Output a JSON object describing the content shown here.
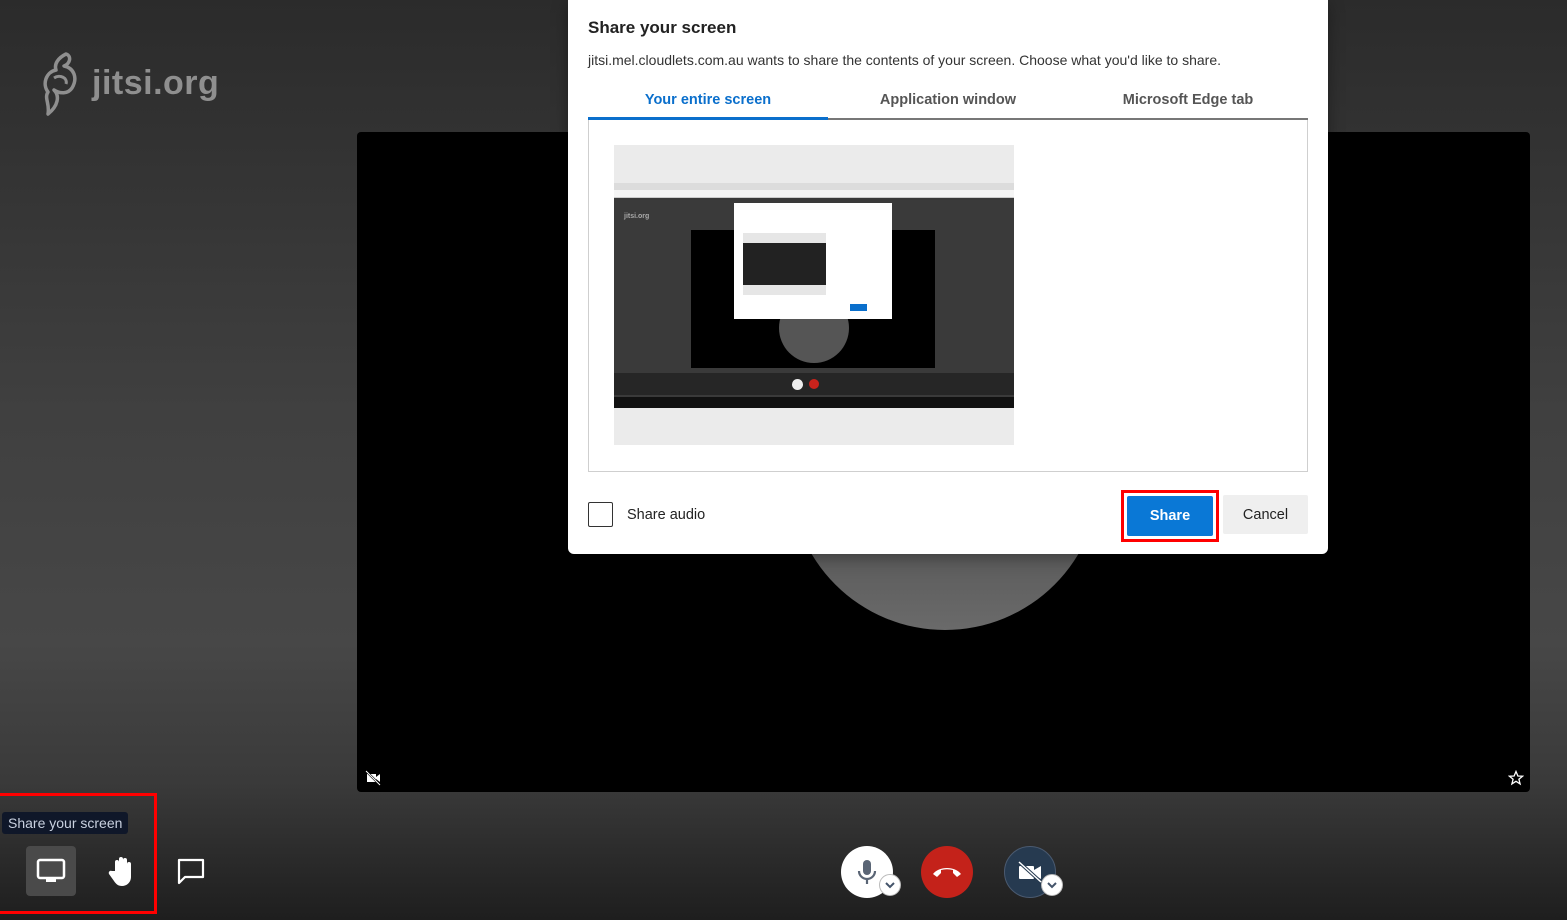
{
  "app": {
    "logo_text": "jitsi.org"
  },
  "dialog": {
    "title": "Share your screen",
    "description": "jitsi.mel.cloudlets.com.au wants to share the contents of your screen. Choose what you'd like to share.",
    "tabs": [
      {
        "label": "Your entire screen",
        "active": true
      },
      {
        "label": "Application window",
        "active": false
      },
      {
        "label": "Microsoft Edge tab",
        "active": false
      }
    ],
    "thumbnail": {
      "name": "Entire screen preview",
      "mini_logo": "jitsi.org"
    },
    "share_audio": {
      "label": "Share audio",
      "checked": false
    },
    "share_button": "Share",
    "cancel_button": "Cancel",
    "accent_color": "#0a78d6"
  },
  "stage": {
    "camera_status": "camera-off",
    "pinned": false
  },
  "toolbar": {
    "tooltip": "Share your screen",
    "left_buttons": [
      {
        "icon": "monitor-icon",
        "label": "Share your screen",
        "active": true
      },
      {
        "icon": "raise-hand-icon",
        "label": "Raise hand"
      },
      {
        "icon": "chat-icon",
        "label": "Chat"
      }
    ],
    "center_buttons": [
      {
        "icon": "microphone-icon",
        "label": "Mute microphone"
      },
      {
        "icon": "hangup-icon",
        "label": "Leave meeting",
        "color": "#c4221a"
      },
      {
        "icon": "camera-off-icon",
        "label": "Start camera"
      }
    ]
  },
  "annotations": {
    "highlight_color": "#ff0000"
  }
}
